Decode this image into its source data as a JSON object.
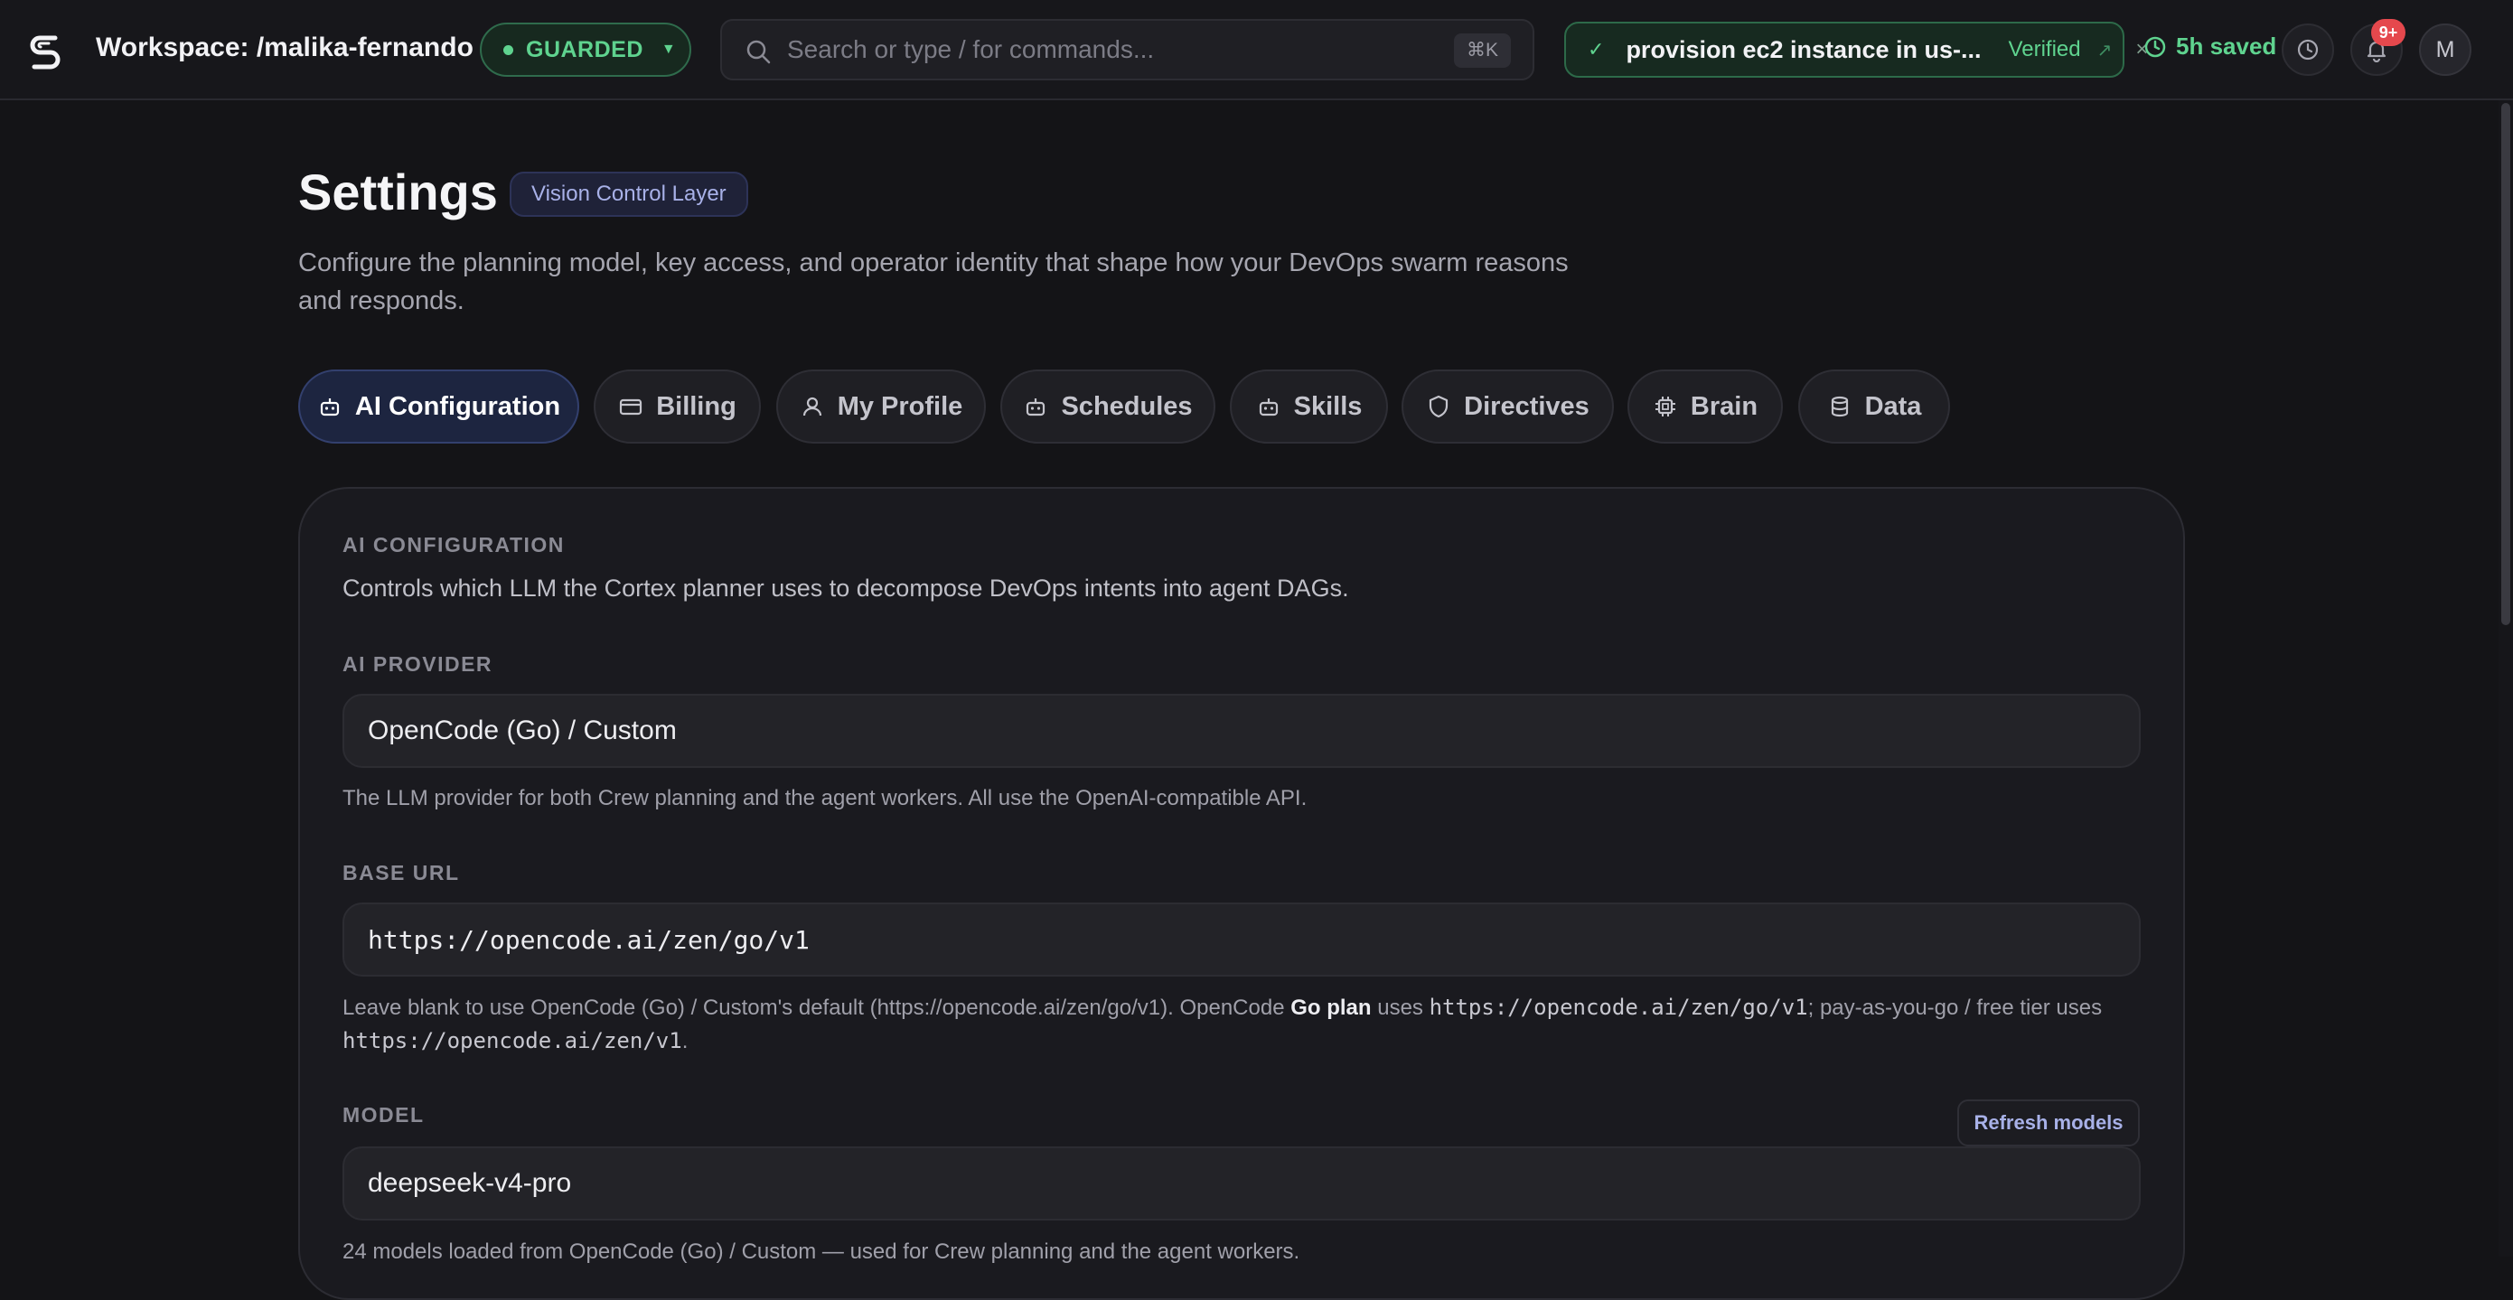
{
  "topbar": {
    "workspace": "Workspace: /malika-fernando",
    "guard_status": "GUARDED",
    "search_placeholder": "Search or type / for commands...",
    "search_shortcut": "⌘K",
    "task_text": "provision ec2 instance in us-...",
    "task_status": "Verified",
    "time_saved": "5h saved",
    "notification_count": "9+",
    "avatar_initial": "M"
  },
  "header": {
    "title": "Settings",
    "badge": "Vision Control Layer",
    "subtitle": "Configure the planning model, key access, and operator identity that shape how your DevOps swarm reasons and responds."
  },
  "tabs": [
    {
      "label": "AI Configuration",
      "icon": "bot-icon",
      "active": true
    },
    {
      "label": "Billing",
      "icon": "credit-card-icon",
      "active": false
    },
    {
      "label": "My Profile",
      "icon": "user-icon",
      "active": false
    },
    {
      "label": "Schedules",
      "icon": "bot-icon",
      "active": false
    },
    {
      "label": "Skills",
      "icon": "bot-icon",
      "active": false
    },
    {
      "label": "Directives",
      "icon": "shield-icon",
      "active": false
    },
    {
      "label": "Brain",
      "icon": "cpu-icon",
      "active": false
    },
    {
      "label": "Data",
      "icon": "database-icon",
      "active": false
    }
  ],
  "panel": {
    "section_title": "AI CONFIGURATION",
    "section_desc": "Controls which LLM the Cortex planner uses to decompose DevOps intents into agent DAGs.",
    "provider": {
      "label": "AI PROVIDER",
      "value": "OpenCode (Go) / Custom",
      "help": "The LLM provider for both Crew planning and the agent workers. All use the OpenAI-compatible API."
    },
    "base_url": {
      "label": "BASE URL",
      "value": "https://opencode.ai/zen/go/v1",
      "help_prefix": "Leave blank to use OpenCode (Go) / Custom's default (https://opencode.ai/zen/go/v1). OpenCode ",
      "help_bold": "Go plan",
      "help_mid": " uses ",
      "help_code1": "https://opencode.ai/zen/go/v1",
      "help_mid2": "; pay-as-you-go / free tier uses",
      "help_code2": "https://opencode.ai/zen/v1",
      "help_end": "."
    },
    "model": {
      "label": "MODEL",
      "refresh_label": "Refresh models",
      "value": "deepseek-v4-pro",
      "help": "24 models loaded from OpenCode (Go) / Custom — used for Crew planning and the agent workers."
    }
  },
  "colors": {
    "accent_green": "#5fd38f",
    "accent_blue": "#a8b1e8",
    "background": "#141417",
    "badge_red": "#e5484d"
  }
}
